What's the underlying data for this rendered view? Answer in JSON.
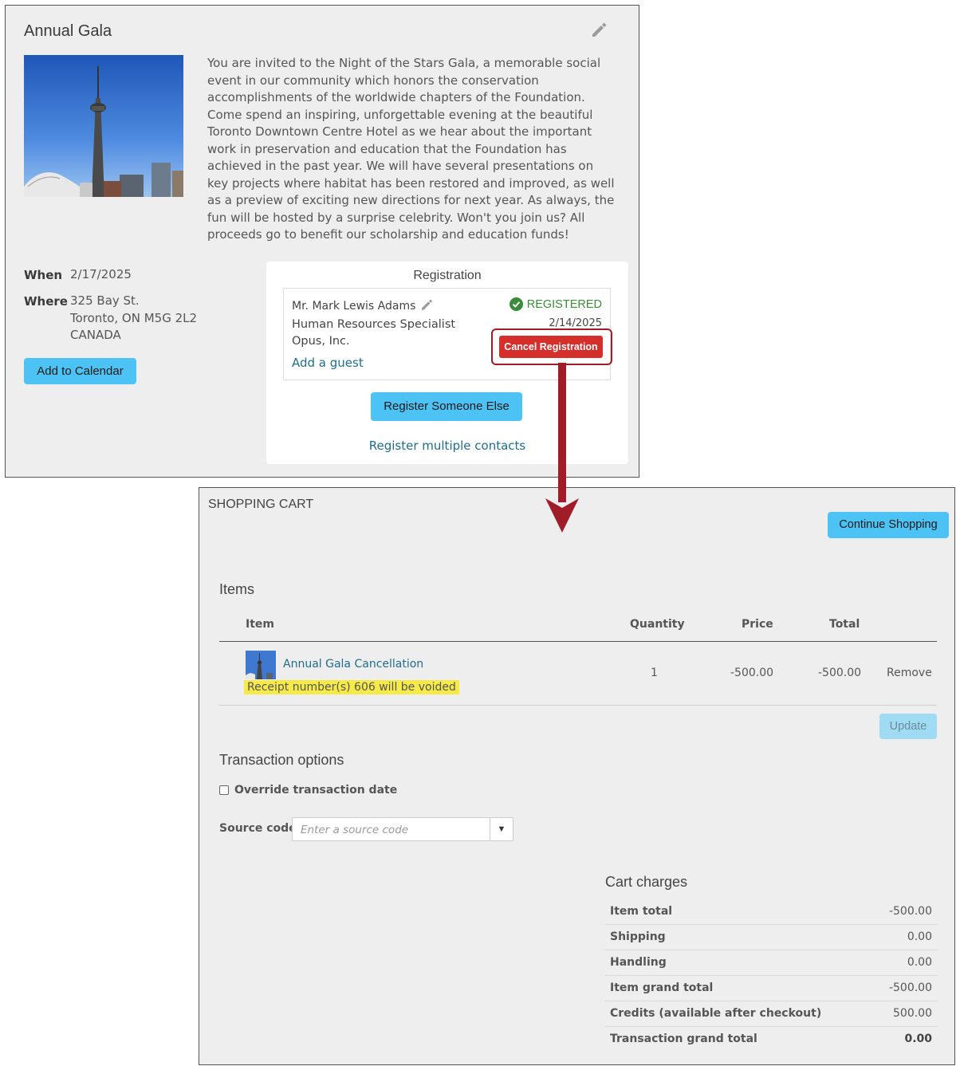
{
  "event": {
    "title": "Annual Gala",
    "description": "You are invited to the Night of the Stars Gala, a memorable social event in our community which honors the conservation accomplishments of the worldwide chapters of the Foundation. Come spend an inspiring, unforgettable evening at the beautiful Toronto Downtown Centre Hotel as we hear about the important work in preservation and education that the Foundation has achieved in the past year. We will have several presentations on key projects where habitat has been restored and improved, as well as a preview of exciting new directions for next year. As always, the fun will be hosted by a surprise celebrity. Won't you join us? All proceeds go to benefit our scholarship and education funds!",
    "when_label": "When",
    "when_value": "2/17/2025",
    "where_label": "Where",
    "address_line1": "325 Bay St.",
    "address_line2": "Toronto, ON M5G 2L2",
    "address_line3": "CANADA",
    "add_to_calendar": "Add to Calendar"
  },
  "registration": {
    "title": "Registration",
    "registrant_name": "Mr. Mark Lewis Adams",
    "job_title": "Human Resources Specialist",
    "company": "Opus, Inc.",
    "status": "REGISTERED",
    "status_date": "2/14/2025",
    "cancel_button": "Cancel Registration",
    "add_guest": "Add a guest",
    "register_someone_else": "Register Someone Else",
    "register_multiple": "Register multiple contacts"
  },
  "cart": {
    "heading": "SHOPPING CART",
    "continue_shopping": "Continue Shopping",
    "items_title": "Items",
    "columns": {
      "item": "Item",
      "quantity": "Quantity",
      "price": "Price",
      "total": "Total"
    },
    "items": [
      {
        "name": "Annual Gala Cancellation",
        "note": "Receipt number(s) 606 will be voided",
        "quantity": "1",
        "price": "-500.00",
        "total": "-500.00",
        "remove": "Remove"
      }
    ],
    "update_button": "Update",
    "transaction_options_title": "Transaction options",
    "override_label": "Override transaction date",
    "source_code_label": "Source code",
    "source_code_placeholder": "Enter a source code",
    "charges_title": "Cart charges",
    "charges": [
      {
        "label": "Item total",
        "value": "-500.00"
      },
      {
        "label": "Shipping",
        "value": "0.00"
      },
      {
        "label": "Handling",
        "value": "0.00"
      },
      {
        "label": "Item grand total",
        "value": "-500.00"
      },
      {
        "label": "Credits (available after checkout)",
        "value": "500.00"
      },
      {
        "label": "Transaction grand total",
        "value": "0.00"
      }
    ]
  },
  "colors": {
    "accent_button": "#4dc3f5",
    "cancel_button": "#d42f2a",
    "callout_outline": "#a01c28",
    "registered_green": "#3a8c3a",
    "highlight_yellow": "#f6ea4a"
  }
}
